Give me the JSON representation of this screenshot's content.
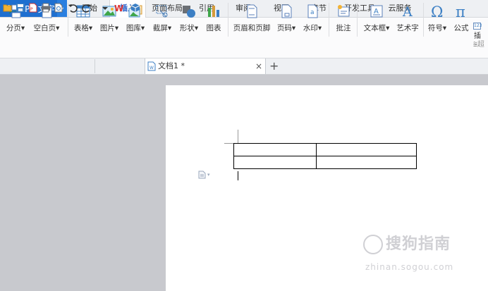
{
  "app": {
    "logo": "W",
    "title": "WPS 文字",
    "dropdown_glyph": "▾"
  },
  "menu": {
    "tabs": [
      "开始",
      "插入",
      "页面布局",
      "引用",
      "审阅",
      "视图",
      "章节",
      "开发工具",
      "云服务"
    ],
    "active": "插入"
  },
  "ribbon": {
    "buttons": [
      {
        "label": "分页",
        "icon": "page-break-icon"
      },
      {
        "label": "空白页",
        "icon": "blank-page-icon"
      },
      {
        "label": "表格",
        "icon": "table-icon"
      },
      {
        "label": "图片",
        "icon": "picture-icon"
      },
      {
        "label": "图库",
        "icon": "gallery-icon"
      },
      {
        "label": "截屏",
        "icon": "screenshot-icon"
      },
      {
        "label": "形状",
        "icon": "shapes-icon"
      },
      {
        "label": "图表",
        "icon": "chart-icon"
      },
      {
        "label": "页眉和页脚",
        "icon": "header-footer-icon"
      },
      {
        "label": "页码",
        "icon": "page-number-icon"
      },
      {
        "label": "水印",
        "icon": "watermark-icon"
      },
      {
        "label": "批注",
        "icon": "comment-icon"
      },
      {
        "label": "文本框",
        "icon": "textbox-icon"
      },
      {
        "label": "艺术字",
        "icon": "wordart-icon"
      },
      {
        "label": "符号",
        "icon": "symbol-icon"
      },
      {
        "label": "公式",
        "icon": "formula-icon"
      }
    ],
    "dropdown_suffix": "▾",
    "overflow_labels": [
      "插",
      "超"
    ]
  },
  "quick_access": {
    "icons": [
      "open-folder-icon",
      "save-icon",
      "export-pdf-icon",
      "print-icon",
      "print-preview-icon",
      "undo-icon",
      "redo-icon",
      "customize-icon",
      "wps-logo-icon",
      "cloud-box-icon"
    ]
  },
  "document_tab": {
    "label": "文档1 *",
    "close_glyph": "×",
    "add_glyph": "+"
  },
  "document": {
    "table": {
      "rows": 2,
      "cols": 2,
      "cells": [
        [
          "",
          ""
        ],
        [
          "",
          ""
        ]
      ]
    },
    "paste_options_glyph": "▾"
  },
  "watermark": {
    "text": "搜狗指南",
    "url": "zhinan.sogou.com"
  },
  "colors": {
    "accent": "#1e6fd0",
    "active_tab_text": "#2a62c9",
    "workspace": "#c8c9ce"
  }
}
